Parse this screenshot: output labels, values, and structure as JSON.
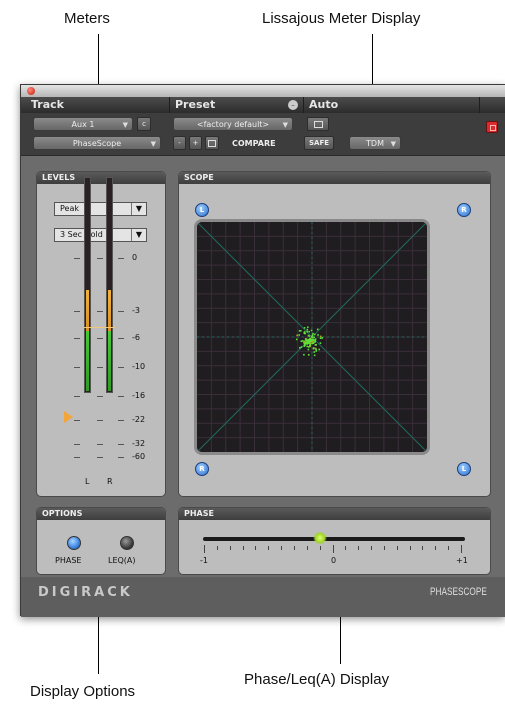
{
  "callouts": {
    "meters": "Meters",
    "lissajous": "Lissajous Meter Display",
    "display_options": "Display Options",
    "phase_display": "Phase/Leq(A) Display"
  },
  "header": {
    "track_label": "Track",
    "preset_label": "Preset",
    "auto_label": "Auto"
  },
  "controls": {
    "track_name": "Aux 1",
    "channel_btn": "c",
    "plugin_name": "PhaseScope",
    "preset_value": "<factory default>",
    "minus": "-",
    "plus": "+",
    "compare": "COMPARE",
    "safe": "SAFE",
    "tdm": "TDM"
  },
  "levels": {
    "title": "LEVELS",
    "mode": "Peak",
    "hold": "3 Sec Hold",
    "scale": [
      "0",
      "-3",
      "-6",
      "-10",
      "-16",
      "-22",
      "-32",
      "-60"
    ],
    "left_label": "L",
    "right_label": "R",
    "left_level_fraction": 0.28,
    "right_level_fraction": 0.28,
    "orange_top_fraction": 0.53
  },
  "scope": {
    "title": "SCOPE",
    "corner_tl": "L",
    "corner_tr": "R",
    "corner_bl": "R",
    "corner_br": "L"
  },
  "options": {
    "title": "OPTIONS",
    "phase_label": "PHASE",
    "leq_label": "LEQ(A)",
    "phase_selected": true
  },
  "phase": {
    "title": "PHASE",
    "min_label": "-1",
    "mid_label": "0",
    "max_label": "+1",
    "value": -0.1
  },
  "footer": {
    "brand": "DIGIRACK",
    "product": "PHASESCOPE"
  },
  "colors": {
    "meter_green": "#3fbf2c",
    "meter_orange": "#e8a232",
    "scope_dots": "#5fe23a",
    "selected_led": "#3b83e0"
  }
}
